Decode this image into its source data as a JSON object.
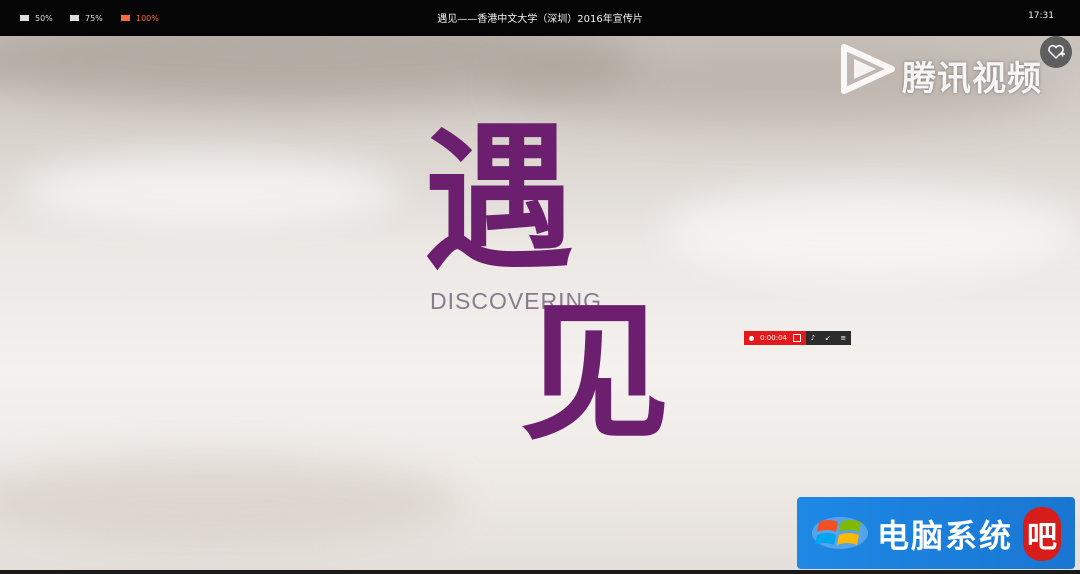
{
  "topbar": {
    "size_options": [
      {
        "label": "50%",
        "active": false
      },
      {
        "label": "75%",
        "active": false
      },
      {
        "label": "100%",
        "active": true
      }
    ],
    "title": "遇见——香港中文大学（深圳）2016年宣传片",
    "clock": "17:31"
  },
  "video": {
    "char_top": "遇",
    "subtitle_en": "DISCOVERING",
    "char_bottom": "见",
    "provider_logo_text": "腾讯视频",
    "favorite_icon": "heart-plus-icon",
    "text_color": "#6b1f6e"
  },
  "recorder": {
    "time": "0:00:04",
    "icons": [
      "record-dot-icon",
      "stop-icon",
      "microphone-icon",
      "minimize-icon",
      "menu-icon"
    ]
  },
  "watermark": {
    "text": "电脑系统",
    "badge": "吧",
    "bg_color": "#1e88e5"
  }
}
